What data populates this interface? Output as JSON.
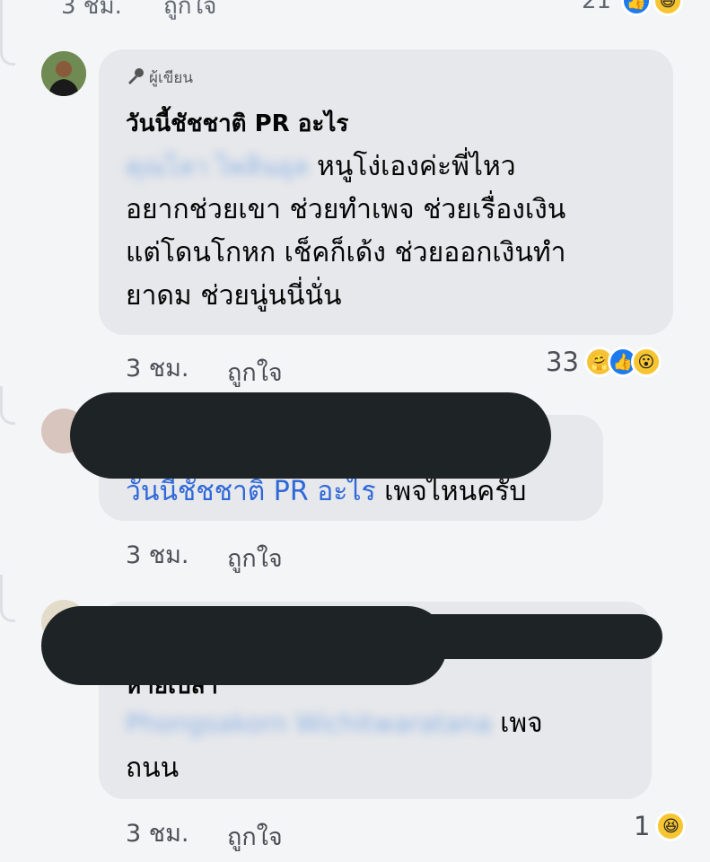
{
  "top": {
    "time": "3 ชม.",
    "like": "ถูกใจ",
    "count": "21"
  },
  "comment1": {
    "author_tag": "ผู้เขียน",
    "name": "วันนี้ชัชชาติ PR อะไร",
    "mention": "คุณไลา ไพลินอุล",
    "line1": "หนูโง่เองค่ะพี่ไหว",
    "line2": "อยากช่วยเขา ช่วยทำเพจ ช่วยเรื่องเงิน",
    "line3": "แต่โดนโกหก เช็คก็เด้ง ช่วยออกเงินทำ",
    "line4": "ยาดม ช่วยนู่นนี่นั่น",
    "time": "3 ชม.",
    "like": "ถูกใจ",
    "reaction_count": "33",
    "reactions": [
      "care-emoji",
      "like-emoji",
      "wow-emoji"
    ]
  },
  "comment2": {
    "mention": "วันนี้ชัชชาติ PR อะไร",
    "text": " เพจไหนครับ",
    "time": "3 ชม.",
    "like": "ถูกใจ"
  },
  "comment3": {
    "partial_line": "หายเปลา",
    "mention": "Phongsakorn Wichitwaratana",
    "text": " เพจ",
    "line2": "ถนน",
    "time": "3 ชม.",
    "like": "ถูกใจ",
    "reaction_count": "1",
    "reactions": [
      "haha-emoji"
    ]
  },
  "colors": {
    "bubble": "#e6e8eb",
    "link": "#2f68d8",
    "like": "#1d7bf0"
  }
}
